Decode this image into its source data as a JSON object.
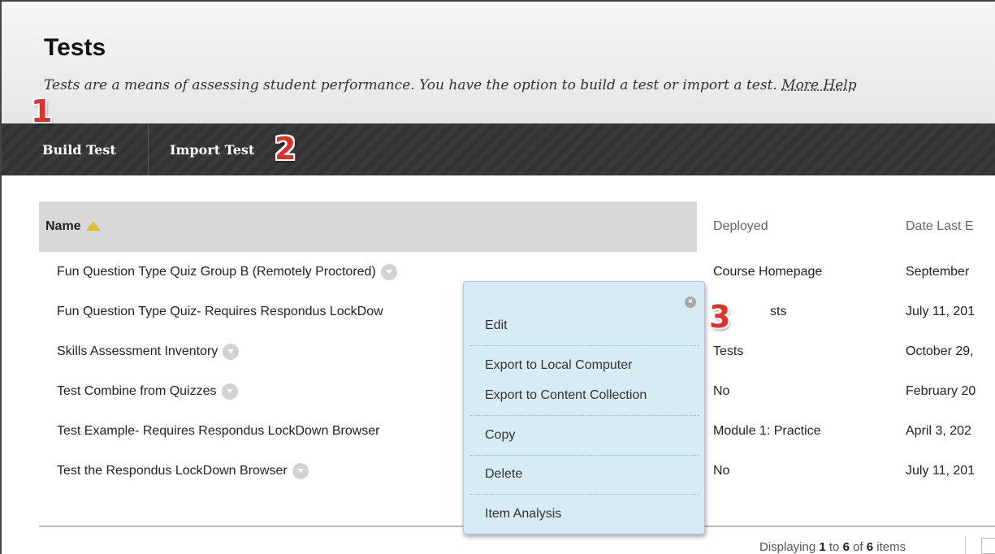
{
  "page": {
    "title": "Tests",
    "instructions": "Tests are a means of assessing student performance. You have the option to build a test or import a test.",
    "more_help": "More Help"
  },
  "action_bar": {
    "build_test": "Build Test",
    "import_test": "Import Test"
  },
  "markers": [
    "1",
    "2",
    "3"
  ],
  "table": {
    "headers": {
      "name": "Name",
      "deployed": "Deployed",
      "date": "Date Last E"
    },
    "rows": [
      {
        "name": "Fun Question Type Quiz Group B (Remotely Proctored)",
        "deployed": "Course Homepage",
        "date": "September"
      },
      {
        "name": "Fun Question Type Quiz- Requires Respondus LockDow",
        "deployed": "sts",
        "date": "July 11, 201"
      },
      {
        "name": "Skills Assessment Inventory",
        "deployed": "Tests",
        "date": "October 29,"
      },
      {
        "name": "Test Combine from Quizzes",
        "deployed": "No",
        "date": "February 20"
      },
      {
        "name": "Test Example- Requires Respondus LockDown Browser",
        "deployed": "Module 1: Practice",
        "date": "April 3, 202"
      },
      {
        "name": "Test the Respondus LockDown Browser",
        "deployed": "No",
        "date": "July 11, 201"
      }
    ]
  },
  "footer": {
    "prefix": "Displaying ",
    "start": "1",
    "mid": " to ",
    "end": "6",
    "suffix": " of ",
    "total": "6",
    "tail": " items"
  },
  "context_menu": {
    "close_symbol": "×",
    "items": [
      "Edit",
      "Export to Local Computer",
      "Export to Content Collection",
      "Copy",
      "Delete",
      "Item Analysis"
    ]
  },
  "colors": {
    "marker": "#e0302a",
    "menu_bg": "#d7ebf2",
    "action_bar": "#3a3a3a",
    "sort_icon": "#e0bd35"
  }
}
